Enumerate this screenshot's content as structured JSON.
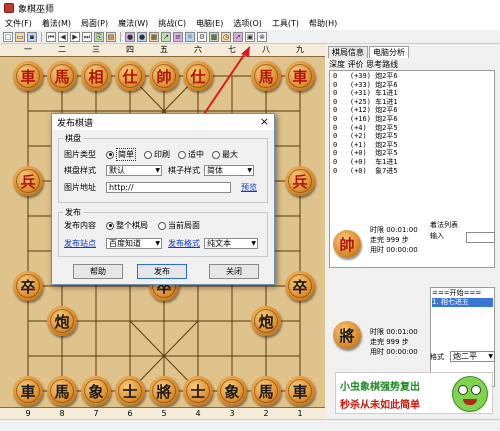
{
  "window": {
    "title": "象棋巫师"
  },
  "menu": [
    "文件(F)",
    "着法(M)",
    "局面(P)",
    "魔法(W)",
    "挑战(C)",
    "电脑(E)",
    "选项(O)",
    "工具(T)",
    "帮助(H)"
  ],
  "board": {
    "top_coords": [
      "一",
      "二",
      "三",
      "四",
      "五",
      "六",
      "七",
      "八",
      "九"
    ],
    "bottom_coords": [
      "9",
      "8",
      "7",
      "6",
      "5",
      "4",
      "3",
      "2",
      "1"
    ],
    "red_pieces": [
      {
        "char": "車",
        "file": 0,
        "rank": 0
      },
      {
        "char": "馬",
        "file": 1,
        "rank": 0
      },
      {
        "char": "相",
        "file": 2,
        "rank": 0
      },
      {
        "char": "仕",
        "file": 3,
        "rank": 0
      },
      {
        "char": "帥",
        "file": 4,
        "rank": 0
      },
      {
        "char": "仕",
        "file": 5,
        "rank": 0
      },
      {
        "char": "馬",
        "file": 7,
        "rank": 0
      },
      {
        "char": "車",
        "file": 8,
        "rank": 0
      },
      {
        "char": "兵",
        "file": 0,
        "rank": 3
      },
      {
        "char": "兵",
        "file": 8,
        "rank": 3
      }
    ],
    "black_pieces": [
      {
        "char": "卒",
        "file": 0,
        "rank": 6
      },
      {
        "char": "卒",
        "file": 4,
        "rank": 6
      },
      {
        "char": "卒",
        "file": 8,
        "rank": 6
      },
      {
        "char": "炮",
        "file": 1,
        "rank": 7
      },
      {
        "char": "炮",
        "file": 7,
        "rank": 7
      },
      {
        "char": "車",
        "file": 0,
        "rank": 9
      },
      {
        "char": "馬",
        "file": 1,
        "rank": 9
      },
      {
        "char": "象",
        "file": 2,
        "rank": 9
      },
      {
        "char": "士",
        "file": 3,
        "rank": 9
      },
      {
        "char": "將",
        "file": 4,
        "rank": 9
      },
      {
        "char": "士",
        "file": 5,
        "rank": 9
      },
      {
        "char": "象",
        "file": 6,
        "rank": 9
      },
      {
        "char": "馬",
        "file": 7,
        "rank": 9
      },
      {
        "char": "車",
        "file": 8,
        "rank": 9
      }
    ]
  },
  "dialog": {
    "title": "发布棋谱",
    "close": "×",
    "board_group": "棋盘",
    "image_type_label": "图片类型",
    "image_types": [
      "简单",
      "印刷",
      "适中",
      "最大"
    ],
    "image_type_selected": 0,
    "board_style_label": "棋盘样式",
    "board_style_value": "默认",
    "piece_style_label": "棋子样式",
    "piece_style_value": "简体",
    "preview_link": "预览",
    "image_url_label": "图片地址",
    "image_url_value": "http://",
    "publish_group": "发布",
    "publish_content_label": "发布内容",
    "publish_options": [
      "整个棋局",
      "当前局面"
    ],
    "publish_selected": 0,
    "publish_site_link": "发布站点",
    "publish_site_value": "百度知道",
    "publish_format_link": "发布格式",
    "publish_format_value": "纯文本",
    "help_btn": "帮助",
    "publish_btn": "发布",
    "close_btn": "关闭"
  },
  "panel": {
    "tabs": [
      "棋局信息",
      "电脑分析"
    ],
    "header": "深度  评价  思考路线",
    "moves": [
      "0   (+39) 炮2平6",
      "0   (+33) 炮2平6",
      "0   (+31) 车1进1",
      "0   (+25) 车1进1",
      "0   (+12) 炮2平6",
      "0   (+16) 炮2平6",
      "0   (+4)  炮2平5",
      "0   (+2)  炮2平5",
      "0   (+1)  炮2平5",
      "0   (+0)  炮2平5",
      "0   (+0)  车1进1",
      "0   (+0)  象7进5"
    ],
    "red_info": {
      "time_limit": "时限  00:01:00",
      "moves": "走完  999  步",
      "used": "用时  00:00:00"
    },
    "black_info": {
      "time_limit": "时限  00:01:00",
      "moves": "走完  999  步",
      "used": "用时  00:00:00"
    },
    "notation_label": "着法列表",
    "input_label": "输入",
    "notation_items": [
      "===开始===",
      "1. 相七进五"
    ],
    "format_label": "格式",
    "format_value": "炮二平",
    "ad_line1": "小虫象棋强势复出",
    "ad_line2": "秒杀从未如此简单",
    "red_general": "帥",
    "black_general": "將"
  }
}
